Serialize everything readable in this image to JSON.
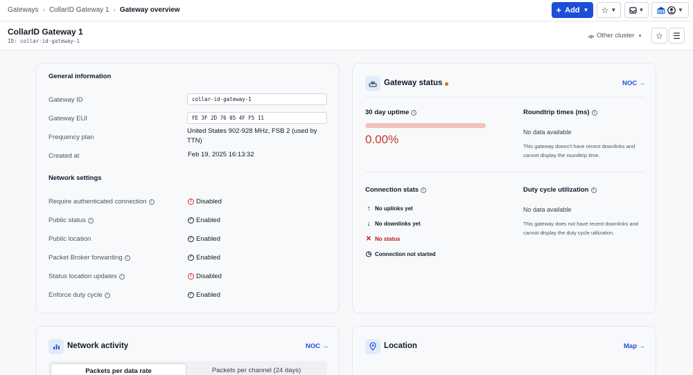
{
  "breadcrumb": [
    "Gateways",
    "CollarID Gateway 1",
    "Gateway overview"
  ],
  "toolbar": {
    "add_label": "Add"
  },
  "header": {
    "title": "CollarID Gateway 1",
    "id_line": "ID: collar-id-gateway-1",
    "cluster": "Other cluster"
  },
  "general": {
    "title": "General information",
    "fields": [
      {
        "label": "Gateway ID",
        "value": "collar-id-gateway-1"
      },
      {
        "label": "Gateway EUI",
        "value": "FE 3F 2D 76 05 4F F5 11"
      },
      {
        "label": "Frequency plan",
        "value": "United States 902-928 MHz, FSB 2 (used by TTN)"
      },
      {
        "label": "Created at",
        "value": "Feb 19, 2025 16:13:32"
      }
    ],
    "network_title": "Network settings",
    "settings": [
      {
        "label": "Require authenticated connection",
        "value": "Disabled"
      },
      {
        "label": "Public status",
        "value": "Enabled"
      },
      {
        "label": "Public location",
        "value": "Enabled"
      },
      {
        "label": "Packet Broker forwarding",
        "value": "Enabled"
      },
      {
        "label": "Status location updates",
        "value": "Disabled"
      },
      {
        "label": "Enforce duty cycle",
        "value": "Enabled"
      }
    ]
  },
  "gateway_status": {
    "title": "Gateway status",
    "link": "NOC →",
    "uptime_label": "30 day uptime",
    "uptime_value": "0.00%",
    "uptime_fraction": 0,
    "roundtrip_label": "Roundtrip times (ms)",
    "roundtrip_nodata": "No data available",
    "roundtrip_note": "This gateway doesn't have recent downlinks and cannot display the roundtrip time.",
    "conn_label": "Connection stats",
    "conn_items": [
      "No uplinks yet",
      "No downlinks yet",
      "No status",
      "Connection not started"
    ],
    "duty_label": "Duty cycle utilization",
    "duty_nodata": "No data available",
    "duty_note": "This gateway does not have recent downlinks and cannot display the duty cycle utilization."
  },
  "network_activity": {
    "title": "Network activity",
    "link": "NOC →",
    "tabs": [
      "Packets per data rate",
      "Packets per channel (24 days)"
    ]
  },
  "location": {
    "title": "Location",
    "link": "Map →"
  },
  "colors": {
    "accent": "#1d4ed8",
    "error": "#dc2626",
    "status_dot": "#d97706",
    "uptime_bar": "#f3c1b9"
  }
}
